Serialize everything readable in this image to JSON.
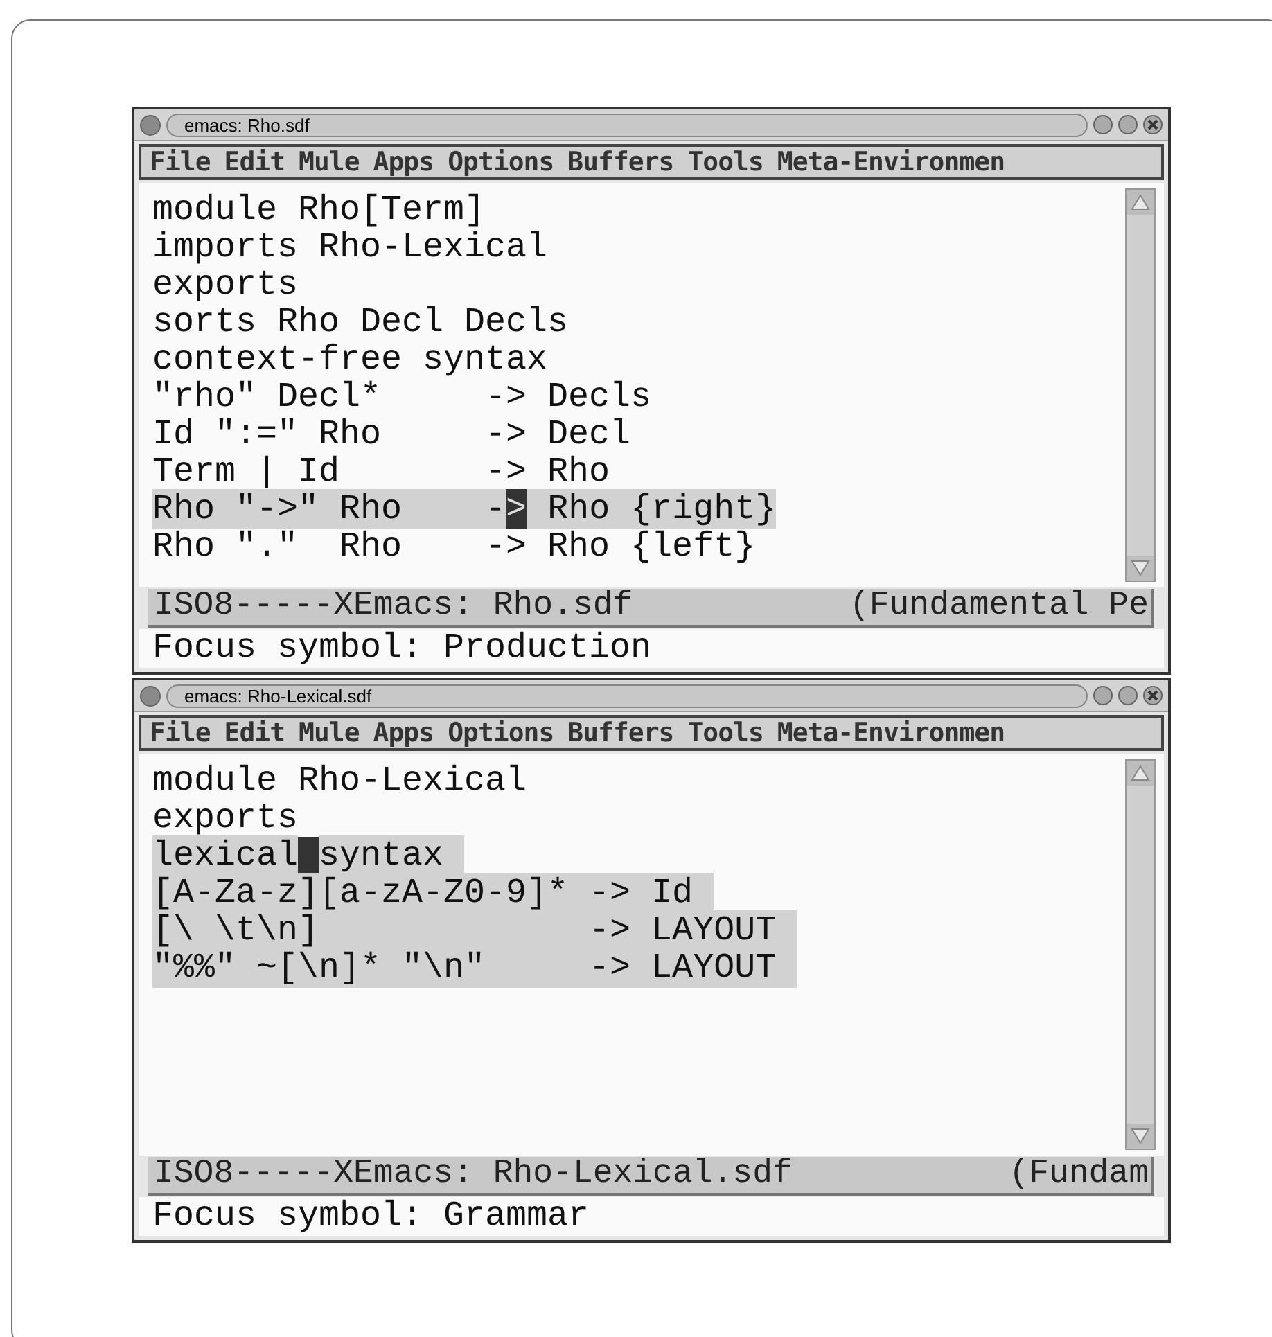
{
  "windows": [
    {
      "title": "emacs: Rho.sdf",
      "menu": [
        "File",
        "Edit",
        "Mule",
        "Apps",
        "Options",
        "Buffers",
        "Tools",
        "Meta-Environmen"
      ],
      "lines": [
        {
          "highlighted": false,
          "segments": [
            {
              "text": "module Rho[Term]",
              "cursor": false
            }
          ]
        },
        {
          "highlighted": false,
          "segments": [
            {
              "text": "imports Rho-Lexical",
              "cursor": false
            }
          ]
        },
        {
          "highlighted": false,
          "segments": [
            {
              "text": "exports",
              "cursor": false
            }
          ]
        },
        {
          "highlighted": false,
          "segments": [
            {
              "text": "sorts Rho Decl Decls",
              "cursor": false
            }
          ]
        },
        {
          "highlighted": false,
          "segments": [
            {
              "text": "context-free syntax",
              "cursor": false
            }
          ]
        },
        {
          "highlighted": false,
          "segments": [
            {
              "text": "\"rho\" Decl*     -> Decls",
              "cursor": false
            }
          ]
        },
        {
          "highlighted": false,
          "segments": [
            {
              "text": "Id \":=\" Rho     -> Decl",
              "cursor": false
            }
          ]
        },
        {
          "highlighted": false,
          "segments": [
            {
              "text": "Term | Id       -> Rho",
              "cursor": false
            }
          ]
        },
        {
          "highlighted": true,
          "segments": [
            {
              "text": "Rho \"->\" Rho    -",
              "cursor": false
            },
            {
              "text": ">",
              "cursor": true
            },
            {
              "text": " Rho {right}",
              "cursor": false
            }
          ]
        },
        {
          "highlighted": false,
          "segments": [
            {
              "text": "Rho \".\"  Rho    -> Rho {left}",
              "cursor": false
            }
          ]
        }
      ],
      "mode_line": {
        "left": "ISO8-----XEmacs: Rho.sdf",
        "right": "(Fundamental Pe"
      },
      "minibuffer": "Focus symbol: Production"
    },
    {
      "title": "emacs: Rho-Lexical.sdf",
      "menu": [
        "File",
        "Edit",
        "Mule",
        "Apps",
        "Options",
        "Buffers",
        "Tools",
        "Meta-Environmen"
      ],
      "lines": [
        {
          "highlighted": false,
          "segments": [
            {
              "text": "module Rho-Lexical",
              "cursor": false
            }
          ]
        },
        {
          "highlighted": false,
          "segments": [
            {
              "text": "exports",
              "cursor": false
            }
          ]
        },
        {
          "highlighted": true,
          "segments": [
            {
              "text": "lexical",
              "cursor": false
            },
            {
              "cursor": true
            },
            {
              "text": "syntax ",
              "cursor": false
            }
          ]
        },
        {
          "highlighted": true,
          "segments": [
            {
              "text": "[A-Za-z][a-zA-Z0-9]* -> Id ",
              "cursor": false
            }
          ]
        },
        {
          "highlighted": true,
          "segments": [
            {
              "text": "[\\ \\t\\n]             -> LAYOUT ",
              "cursor": false
            }
          ]
        },
        {
          "highlighted": true,
          "segments": [
            {
              "text": "\"%%\" ~[\\n]* \"\\n\"     -> LAYOUT ",
              "cursor": false
            }
          ]
        }
      ],
      "mode_line": {
        "left": "ISO8-----XEmacs: Rho-Lexical.sdf",
        "right": "(Fundam"
      },
      "minibuffer": "Focus symbol: Grammar"
    }
  ]
}
